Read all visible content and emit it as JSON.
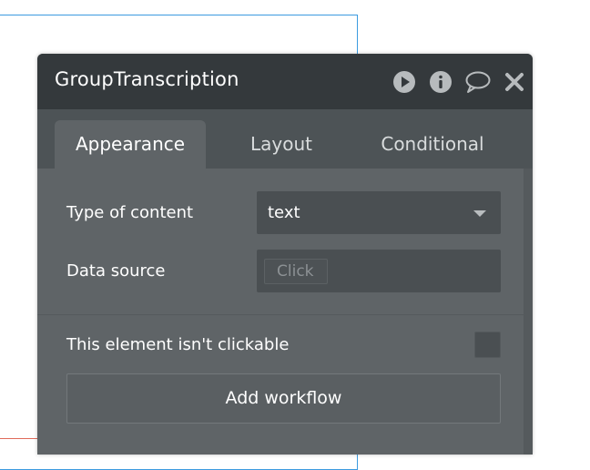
{
  "panel": {
    "title": "GroupTranscription",
    "header_icons": [
      "play-icon",
      "info-icon",
      "comment-icon",
      "close-icon"
    ]
  },
  "tabs": [
    {
      "label": "Appearance",
      "active": true
    },
    {
      "label": "Layout",
      "active": false
    },
    {
      "label": "Conditional",
      "active": false
    }
  ],
  "fields": {
    "type_of_content_label": "Type of content",
    "type_of_content_value": "text",
    "data_source_label": "Data source",
    "data_source_placeholder": "Click",
    "clickable_label": "This element isn't clickable",
    "clickable_checked": false
  },
  "actions": {
    "add_workflow_label": "Add workflow"
  },
  "colors": {
    "header_bg": "#34393c",
    "panel_bg": "#5f6467",
    "tabbar_bg": "#4d5356",
    "input_bg": "#4a4f52",
    "canvas_outline": "#3b9be0"
  }
}
